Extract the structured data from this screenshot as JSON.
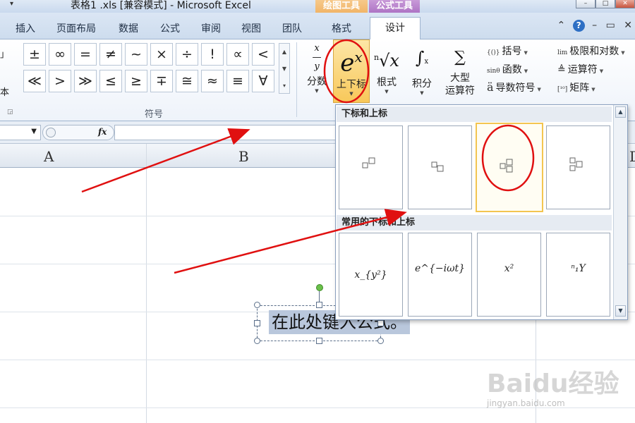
{
  "titlebar": {
    "title": "表格1 .xls  [兼容模式] - Microsoft Excel",
    "qa_dropdown": "▾",
    "context_draw": "绘图工具",
    "context_formula": "公式工具",
    "min_symbol": "–",
    "max_symbol": "□",
    "close_symbol": "✕"
  },
  "tabs": {
    "insert": "插入",
    "page_layout": "页面布局",
    "data": "数据",
    "formulas": "公式",
    "review": "审阅",
    "view": "视图",
    "team": "团队",
    "format": "格式",
    "design": "设计",
    "collapse": "⌃",
    "help": "?",
    "win_min": "–",
    "win_restore": "▭",
    "win_close": "✕"
  },
  "ribbon": {
    "left_stub_top": "」",
    "left_stub_text": "本",
    "symbols_row1": [
      "±",
      "∞",
      "=",
      "≠",
      "~",
      "×",
      "÷",
      "!",
      "∝",
      "<"
    ],
    "symbols_row2": [
      "≪",
      ">",
      "≫",
      "≤",
      "≥",
      "∓",
      "≅",
      "≈",
      "≡",
      "∀"
    ],
    "symbols_group_label": "符号",
    "fraction_label": "分数",
    "subsup_label": "上下标",
    "radical_label": "根式",
    "integral_label": "积分",
    "large_op_label_1": "大型",
    "large_op_label_2": "运算符",
    "bracket_label": "括号",
    "function_label": "函数",
    "accent_label": "导数符号",
    "limit_label": "极限和对数",
    "operator_label": "运算符",
    "matrix_label": "矩阵"
  },
  "formula_bar": {
    "fx": "fx"
  },
  "sheet": {
    "columns": [
      "A",
      "B",
      "D"
    ],
    "textbox_text": "在此处键入公式。"
  },
  "gallery": {
    "section1_title": "下标和上标",
    "section2_title": "常用的下标和上标",
    "common_items": [
      "x_{y²}",
      "e^{−iωt}",
      "x²",
      "ⁿ₁Y"
    ],
    "scroll_up": "▲",
    "scroll_down": "▼"
  },
  "watermark": {
    "brand": "Baidu经验",
    "url": "jingyan.baidu.com"
  },
  "colors": {
    "accent_selected": "#f8c85a",
    "annotation_red": "#e01010"
  }
}
